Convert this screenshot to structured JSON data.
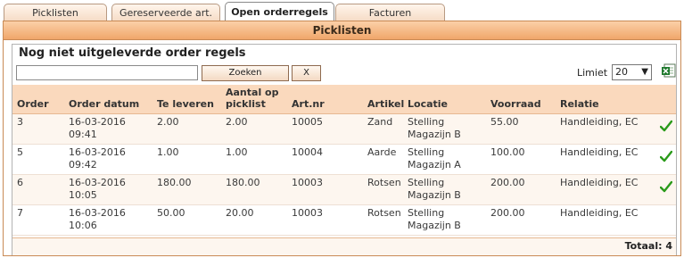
{
  "tabs": [
    {
      "label": "Picklisten"
    },
    {
      "label": "Gereserveerde art."
    },
    {
      "label": "Open orderregels"
    },
    {
      "label": "Facturen"
    }
  ],
  "panel": {
    "title": "Picklisten"
  },
  "section": {
    "heading": "Nog niet uitgeleverde order regels"
  },
  "search": {
    "value": "",
    "placeholder": "",
    "button_label": "Zoeken",
    "clear_label": "X"
  },
  "limit": {
    "label": "Limiet",
    "value": "20"
  },
  "table": {
    "columns": [
      "Order",
      "Order datum",
      "Te leveren",
      "Aantal op picklist",
      "Art.nr",
      "Artikel",
      "Locatie",
      "Voorraad",
      "Relatie"
    ],
    "rows": [
      {
        "order": "3",
        "date": "16-03-2016",
        "time": "09:41",
        "te_leveren": "2.00",
        "aantal": "2.00",
        "artnr": "10005",
        "artikel": "Zand",
        "loc1": "Stelling",
        "loc2": "Magazijn B",
        "voorraad": "55.00",
        "relatie": "Handleiding, EC",
        "checked": true
      },
      {
        "order": "5",
        "date": "16-03-2016",
        "time": "09:42",
        "te_leveren": "1.00",
        "aantal": "1.00",
        "artnr": "10004",
        "artikel": "Aarde",
        "loc1": "Stelling",
        "loc2": "Magazijn A",
        "voorraad": "100.00",
        "relatie": "Handleiding, EC",
        "checked": true
      },
      {
        "order": "6",
        "date": "16-03-2016",
        "time": "10:05",
        "te_leveren": "180.00",
        "aantal": "180.00",
        "artnr": "10003",
        "artikel": "Rotsen",
        "loc1": "Stelling",
        "loc2": "Magazijn B",
        "voorraad": "200.00",
        "relatie": "Handleiding, EC",
        "checked": true
      },
      {
        "order": "7",
        "date": "16-03-2016",
        "time": "10:06",
        "te_leveren": "50.00",
        "aantal": "20.00",
        "artnr": "10003",
        "artikel": "Rotsen",
        "loc1": "Stelling",
        "loc2": "Magazijn B",
        "voorraad": "200.00",
        "relatie": "Handleiding, EC",
        "checked": false
      }
    ],
    "total": "Totaal: 4"
  },
  "colors": {
    "accent": "#f0a66a",
    "header_row": "#fad9bd",
    "check": "#2a9a1a"
  },
  "icons": {
    "export": "excel-icon",
    "row_status": "check-icon"
  }
}
